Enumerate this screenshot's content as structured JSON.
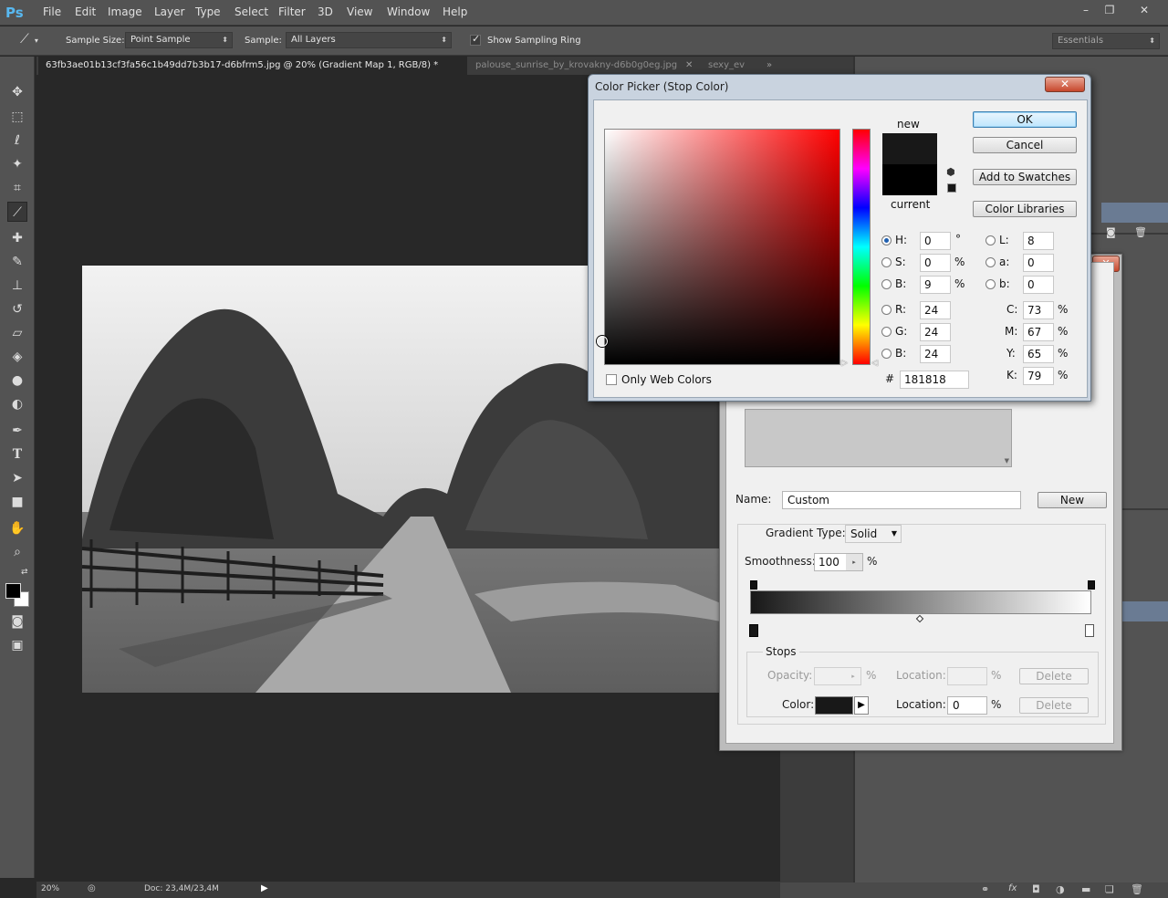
{
  "app": {
    "logo": "Ps",
    "menu": [
      "File",
      "Edit",
      "Image",
      "Layer",
      "Type",
      "Select",
      "Filter",
      "3D",
      "View",
      "Window",
      "Help"
    ],
    "window_controls": {
      "minimize": "–",
      "restore": "❐",
      "close": "✕"
    }
  },
  "options": {
    "sample_size_label": "Sample Size:",
    "sample_size_value": "Point Sample",
    "sample_label": "Sample:",
    "sample_value": "All Layers",
    "show_ring_label": "Show Sampling Ring",
    "show_ring_checked": true,
    "workspace": "Essentials"
  },
  "tabs": [
    {
      "label": "63fb3ae01b13cf3fa56c1b49dd7b3b17-d6bfrm5.jpg @ 20% (Gradient Map 1, RGB/8) *",
      "active": true
    },
    {
      "label": "palouse_sunrise_by_krovakny-d6b0g0eg.jpg",
      "active": false
    },
    {
      "label": "sexy_ev",
      "active": false
    }
  ],
  "status": {
    "zoom": "20%",
    "doc": "Doc: 23,4M/23,4M"
  },
  "color_picker": {
    "title": "Color Picker (Stop Color)",
    "new_label": "new",
    "current_label": "current",
    "new_color": "#181818",
    "current_color": "#000000",
    "ok": "OK",
    "cancel": "Cancel",
    "add_swatches": "Add to Swatches",
    "color_libraries": "Color Libraries",
    "only_web": "Only Web Colors",
    "hsb": [
      {
        "label": "H:",
        "value": "0",
        "unit": "°",
        "selected": true
      },
      {
        "label": "S:",
        "value": "0",
        "unit": "%",
        "selected": false
      },
      {
        "label": "B:",
        "value": "9",
        "unit": "%",
        "selected": false
      }
    ],
    "rgb": [
      {
        "label": "R:",
        "value": "24"
      },
      {
        "label": "G:",
        "value": "24"
      },
      {
        "label": "B:",
        "value": "24"
      }
    ],
    "lab": [
      {
        "label": "L:",
        "value": "8"
      },
      {
        "label": "a:",
        "value": "0"
      },
      {
        "label": "b:",
        "value": "0"
      }
    ],
    "cmyk": [
      {
        "label": "C:",
        "value": "73",
        "unit": "%"
      },
      {
        "label": "M:",
        "value": "67",
        "unit": "%"
      },
      {
        "label": "Y:",
        "value": "65",
        "unit": "%"
      },
      {
        "label": "K:",
        "value": "79",
        "unit": "%"
      }
    ],
    "hex_label": "#",
    "hex": "181818"
  },
  "gradient_editor": {
    "name_label": "Name:",
    "name_value": "Custom",
    "new_button": "New",
    "gradient_type_label": "Gradient Type:",
    "gradient_type_value": "Solid",
    "smoothness_label": "Smoothness:",
    "smoothness_value": "100",
    "smoothness_unit": "%",
    "stops_label": "Stops",
    "opacity_label": "Opacity:",
    "opacity_unit": "%",
    "location_label": "Location:",
    "location_unit": "%",
    "delete": "Delete",
    "color_label": "Color:",
    "color_location_value": "0",
    "stop_color": "#181818"
  }
}
